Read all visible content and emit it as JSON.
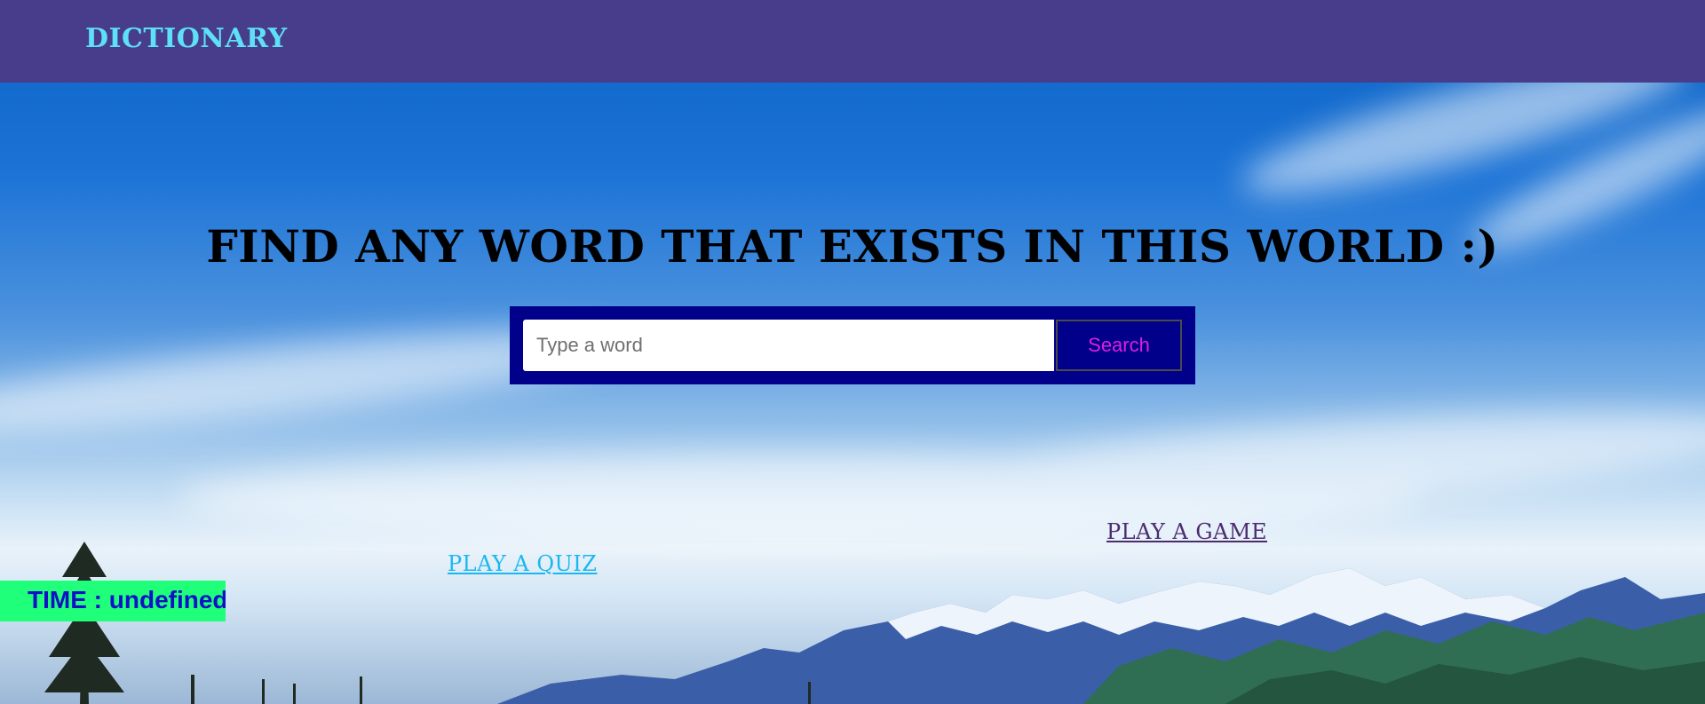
{
  "navbar": {
    "brand": "DICTIONARY"
  },
  "main": {
    "headline": "FIND ANY WORD THAT EXISTS IN THIS WORLD :)",
    "search": {
      "placeholder": "Type a word",
      "value": "",
      "button_label": "Search"
    },
    "links": {
      "quiz": "PLAY A QUIZ",
      "game": "PLAY A GAME"
    }
  },
  "timer": {
    "text": "TIME : undefined"
  },
  "colors": {
    "navbar_bg": "#483d8b",
    "brand": "#5ee0f7",
    "search_box_bg": "#00008b",
    "search_button_text": "#e11de0",
    "quiz_link": "#1ab8f0",
    "game_link": "#4b2c6e",
    "timer_bg": "#1fff7a",
    "timer_text": "#1010c8"
  }
}
